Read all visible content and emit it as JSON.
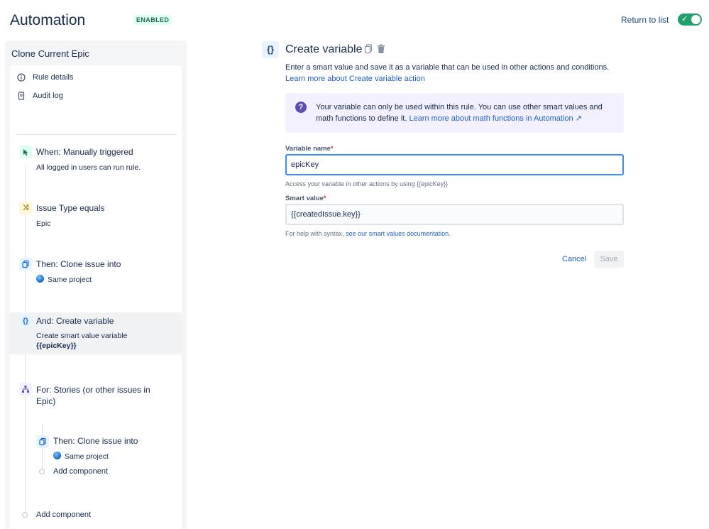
{
  "header": {
    "title": "Automation",
    "status_badge": "ENABLED",
    "return_link": "Return to list",
    "toggle_on": true
  },
  "sidebar": {
    "rule_name": "Clone Current Epic",
    "menu": [
      {
        "label": "Rule details",
        "icon": "info-icon"
      },
      {
        "label": "Audit log",
        "icon": "document-icon"
      }
    ],
    "steps": [
      {
        "title": "When: Manually triggered",
        "sub": "All logged in users can run rule.",
        "icon": "cursor-click-icon"
      },
      {
        "title": "Issue Type equals",
        "sub": "Epic",
        "icon": "shuffle-icon"
      },
      {
        "title": "Then: Clone issue into",
        "sub": "Same project",
        "icon": "clone-icon"
      },
      {
        "title": "And: Create variable",
        "sub": "Create smart value variable",
        "sub_bold": "{{epicKey}}",
        "icon": "braces-icon"
      },
      {
        "title": "For: Stories (or other issues in Epic)",
        "icon": "hierarchy-icon"
      },
      {
        "title": "Then: Clone issue into",
        "sub": "Same project",
        "icon": "clone-icon"
      }
    ],
    "add_component_inner": "Add component",
    "add_component_outer": "Add component"
  },
  "main": {
    "icon_glyph": "{}",
    "title": "Create variable",
    "desc_text": "Enter a smart value and save it as a variable that can be used in other actions and conditions.",
    "desc_link": "Learn more about Create variable action",
    "info_text": "Your variable can only be used within this rule. You can use other smart values and math functions to define it.",
    "info_link": "Learn more about math functions in Automation ↗",
    "variable_name_label": "Variable name",
    "variable_name_value": "epicKey",
    "variable_helper": "Access your variable in other actions by using {{epicKey}}",
    "smart_value_label": "Smart value",
    "smart_value_value": "{{createdIssue.key}}",
    "smart_helper_text": "For help with syntax,",
    "smart_helper_link": "see our smart values documentation.",
    "cancel_label": "Cancel",
    "save_label": "Save"
  }
}
